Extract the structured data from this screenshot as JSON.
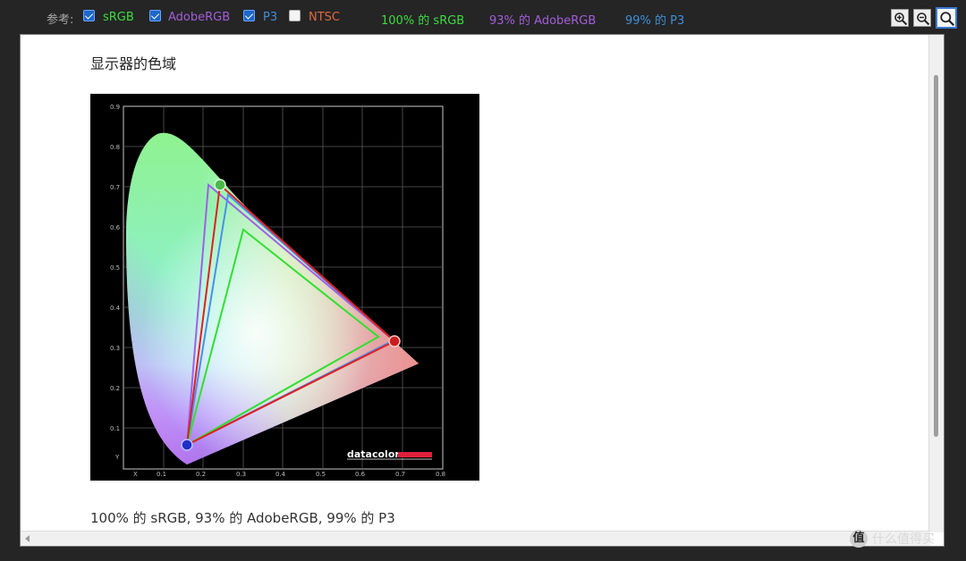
{
  "toolbar": {
    "reference_label": "参考:",
    "options": [
      {
        "label": "sRGB",
        "checked": true,
        "color": "#3ddc3d"
      },
      {
        "label": "AdobeRGB",
        "checked": true,
        "color": "#a35dd8"
      },
      {
        "label": "P3",
        "checked": true,
        "color": "#3e8fd8"
      },
      {
        "label": "NTSC",
        "checked": false,
        "color": "#e06a3a"
      }
    ],
    "coverage": [
      {
        "text": "100% 的 sRGB",
        "color": "#3ddc3d"
      },
      {
        "text": "93% 的 AdobeRGB",
        "color": "#a35dd8"
      },
      {
        "text": "99% 的 P3",
        "color": "#3e8fd8"
      }
    ],
    "zoom_buttons": [
      "zoom-in-icon",
      "zoom-out-icon",
      "zoom-fit-icon"
    ]
  },
  "content": {
    "heading": "显示器的色域",
    "caption": "100% 的 sRGB, 93% 的 AdobeRGB, 99% 的 P3"
  },
  "chart": {
    "y_ticks": [
      "0.9",
      "0.8",
      "0.7",
      "0.6",
      "0.5",
      "0.4",
      "0.3",
      "0.2",
      "0.1",
      "Y"
    ],
    "x_ticks": [
      "X",
      "0.1",
      "0.2",
      "0.3",
      "0.4",
      "0.5",
      "0.6",
      "0.7",
      "0.8"
    ],
    "brand": "datacolor",
    "brand_bar_color": "#e0203a"
  },
  "watermark": {
    "logo": "值",
    "text": "什么值得买"
  }
}
